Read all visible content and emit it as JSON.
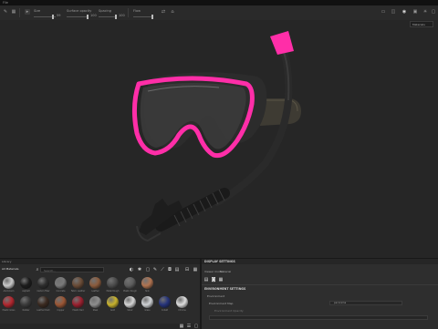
{
  "menubar": {
    "label": "File"
  },
  "toolbar": {
    "size_label": "Size",
    "size_value": "59",
    "opacity_label": "Surface opacity",
    "opacity_value": "100",
    "spacing_label": "Spacing",
    "spacing_value": "100",
    "flow_label": "Flow",
    "flow_value": "100",
    "icons_left": [
      "pencil-icon",
      "grid-icon",
      "cursor-icon"
    ],
    "icons_right": [
      "frame-icon",
      "cube-icon",
      "camera-icon",
      "render-icon",
      "light-icon",
      "capture-icon"
    ]
  },
  "viewport": {
    "search_tag": "Materials",
    "object": "snorkel-mask-model",
    "accent_color": "#ff2ea8",
    "body_color": "#2c2c2c"
  },
  "library": {
    "header": "Library",
    "section": "All Materials",
    "search_placeholder": "Search...",
    "materials_row1": [
      {
        "label": "Aluminium",
        "color": "#c9c9c9"
      },
      {
        "label": "Asphalt",
        "color": "#1c1c1c"
      },
      {
        "label": "Carbon Fiber",
        "color": "#2d2d2d"
      },
      {
        "label": "Concrete",
        "color": "#7a7a7a"
      },
      {
        "label": "Fabric Leather",
        "color": "#6a4b36"
      },
      {
        "label": "Leather",
        "color": "#8b5b3c"
      },
      {
        "label": "Metal Rough",
        "color": "#4b4b4b"
      },
      {
        "label": "Plastic Rough",
        "color": "#5d5d5d"
      },
      {
        "label": "Skin",
        "color": "#b07350"
      }
    ],
    "materials_row2": [
      {
        "label": "Plastic Gloss",
        "color": "#b3262e"
      },
      {
        "label": "Rubber",
        "color": "#3a3a3a"
      },
      {
        "label": "Leather Dark",
        "color": "#3b2a20"
      },
      {
        "label": "Copper",
        "color": "#9b5634"
      },
      {
        "label": "Plastic Red",
        "color": "#9a1f2e"
      },
      {
        "label": "Steel",
        "color": "#8e8e8e"
      },
      {
        "label": "Gold",
        "color": "#c9b32c"
      },
      {
        "label": "Silver",
        "color": "#d6d6d6"
      },
      {
        "label": "Glass",
        "color": "#d0d3d6"
      },
      {
        "label": "Cobalt",
        "color": "#25337a"
      },
      {
        "label": "Chrome",
        "color": "#dedede"
      }
    ]
  },
  "display_settings": {
    "title": "DISPLAY SETTINGS",
    "tab1": "Viewer mode",
    "tab2": "Material",
    "env_heading": "ENVIRONMENT SETTINGS",
    "env_label": "Environment",
    "env_map_label": "Environment Map",
    "env_map_value": "panorama",
    "opacity_label": "Environment Opacity"
  }
}
